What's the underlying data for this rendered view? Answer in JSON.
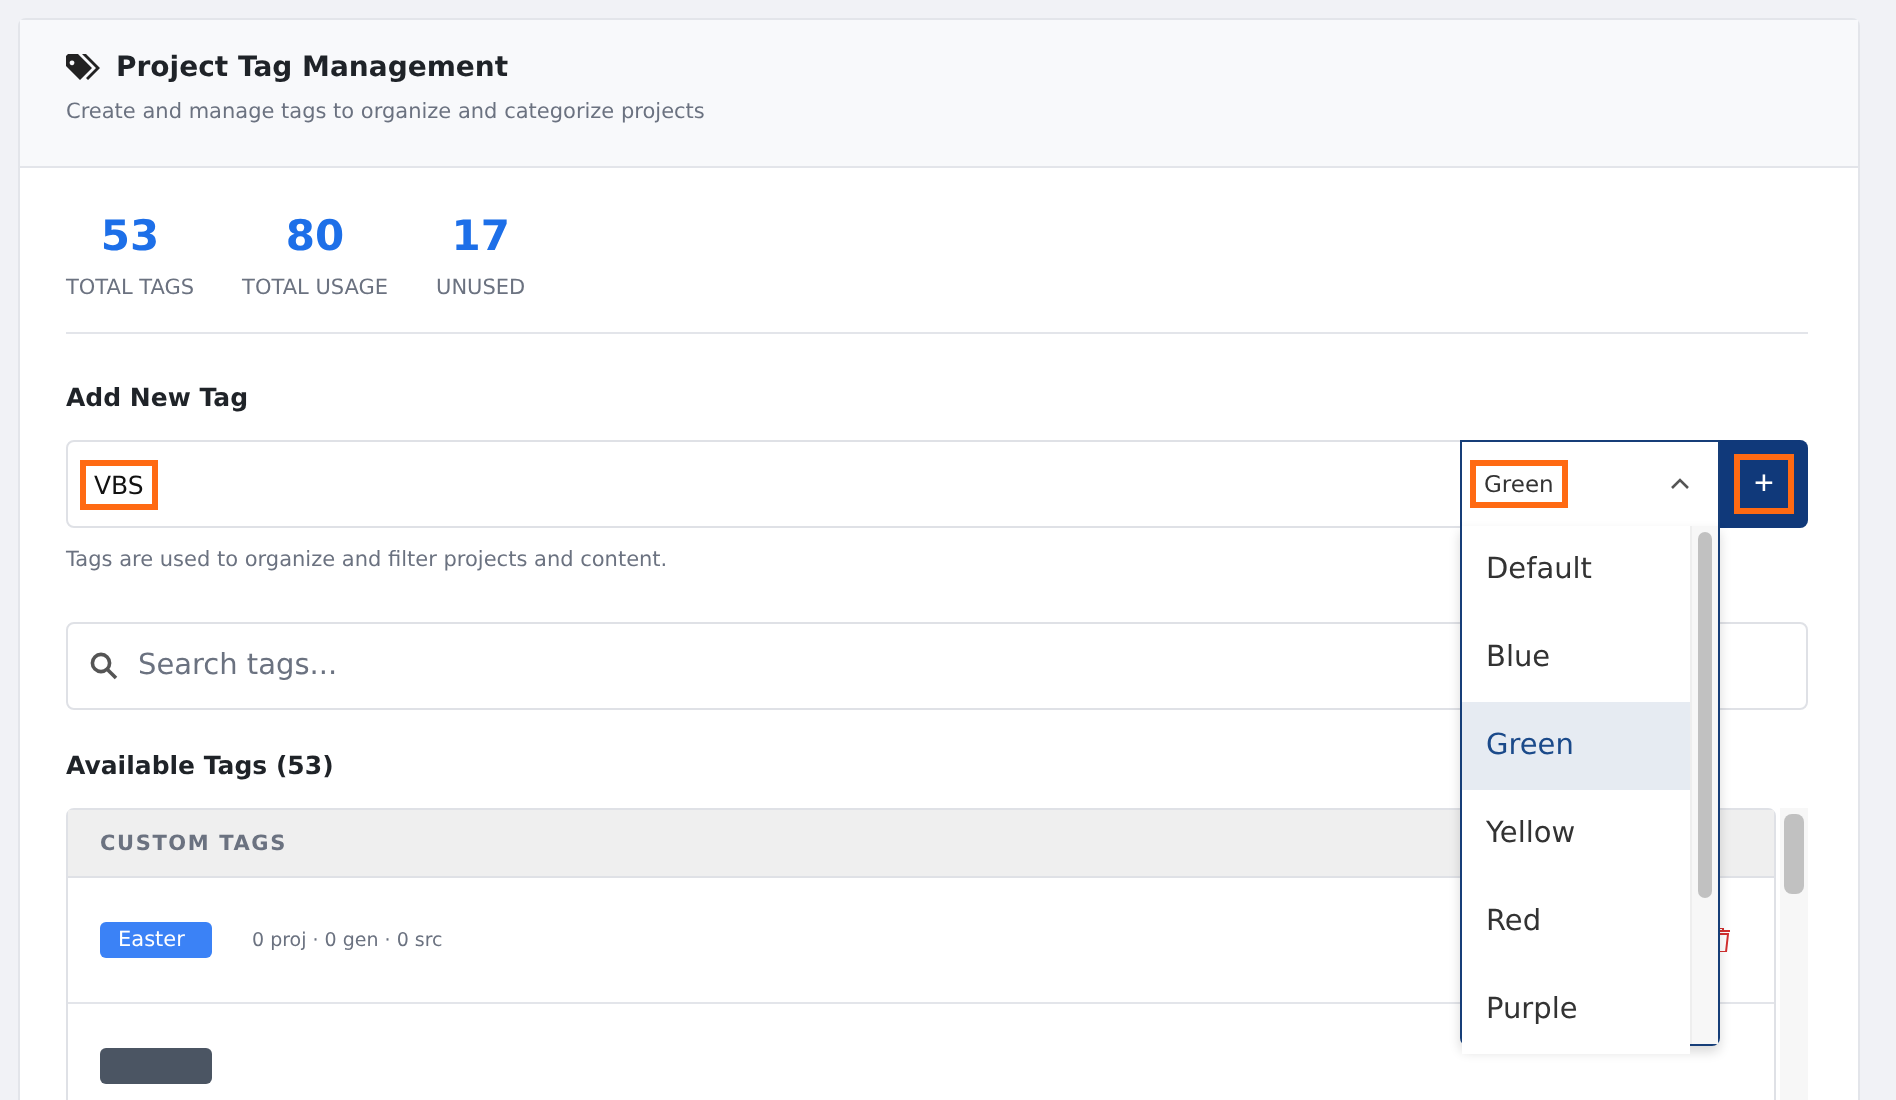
{
  "header": {
    "title": "Project Tag Management",
    "subtitle": "Create and manage tags to organize and categorize projects"
  },
  "stats": [
    {
      "value": "53",
      "label": "TOTAL TAGS"
    },
    {
      "value": "80",
      "label": "TOTAL USAGE"
    },
    {
      "value": "17",
      "label": "UNUSED"
    }
  ],
  "add_tag": {
    "heading": "Add New Tag",
    "value": "VBS",
    "value_highlighted": true,
    "color_select": {
      "value": "Green",
      "highlighted": true,
      "expanded": true,
      "options": [
        {
          "label": "Default",
          "selected": false
        },
        {
          "label": "Blue",
          "selected": false
        },
        {
          "label": "Green",
          "selected": true
        },
        {
          "label": "Yellow",
          "selected": false
        },
        {
          "label": "Red",
          "selected": false
        },
        {
          "label": "Purple",
          "selected": false
        }
      ]
    },
    "add_button": {
      "label": "+",
      "highlighted": true
    },
    "help": "Tags are used to organize and filter projects and content."
  },
  "search": {
    "placeholder": "Search tags..."
  },
  "available": {
    "heading": "Available Tags (53)",
    "group": "CUSTOM TAGS",
    "rows": [
      {
        "tag": "Easter",
        "color": "#3b82f6",
        "meta": "0 proj · 0 gen · 0 src"
      },
      {
        "color": "#4b5563"
      }
    ]
  }
}
